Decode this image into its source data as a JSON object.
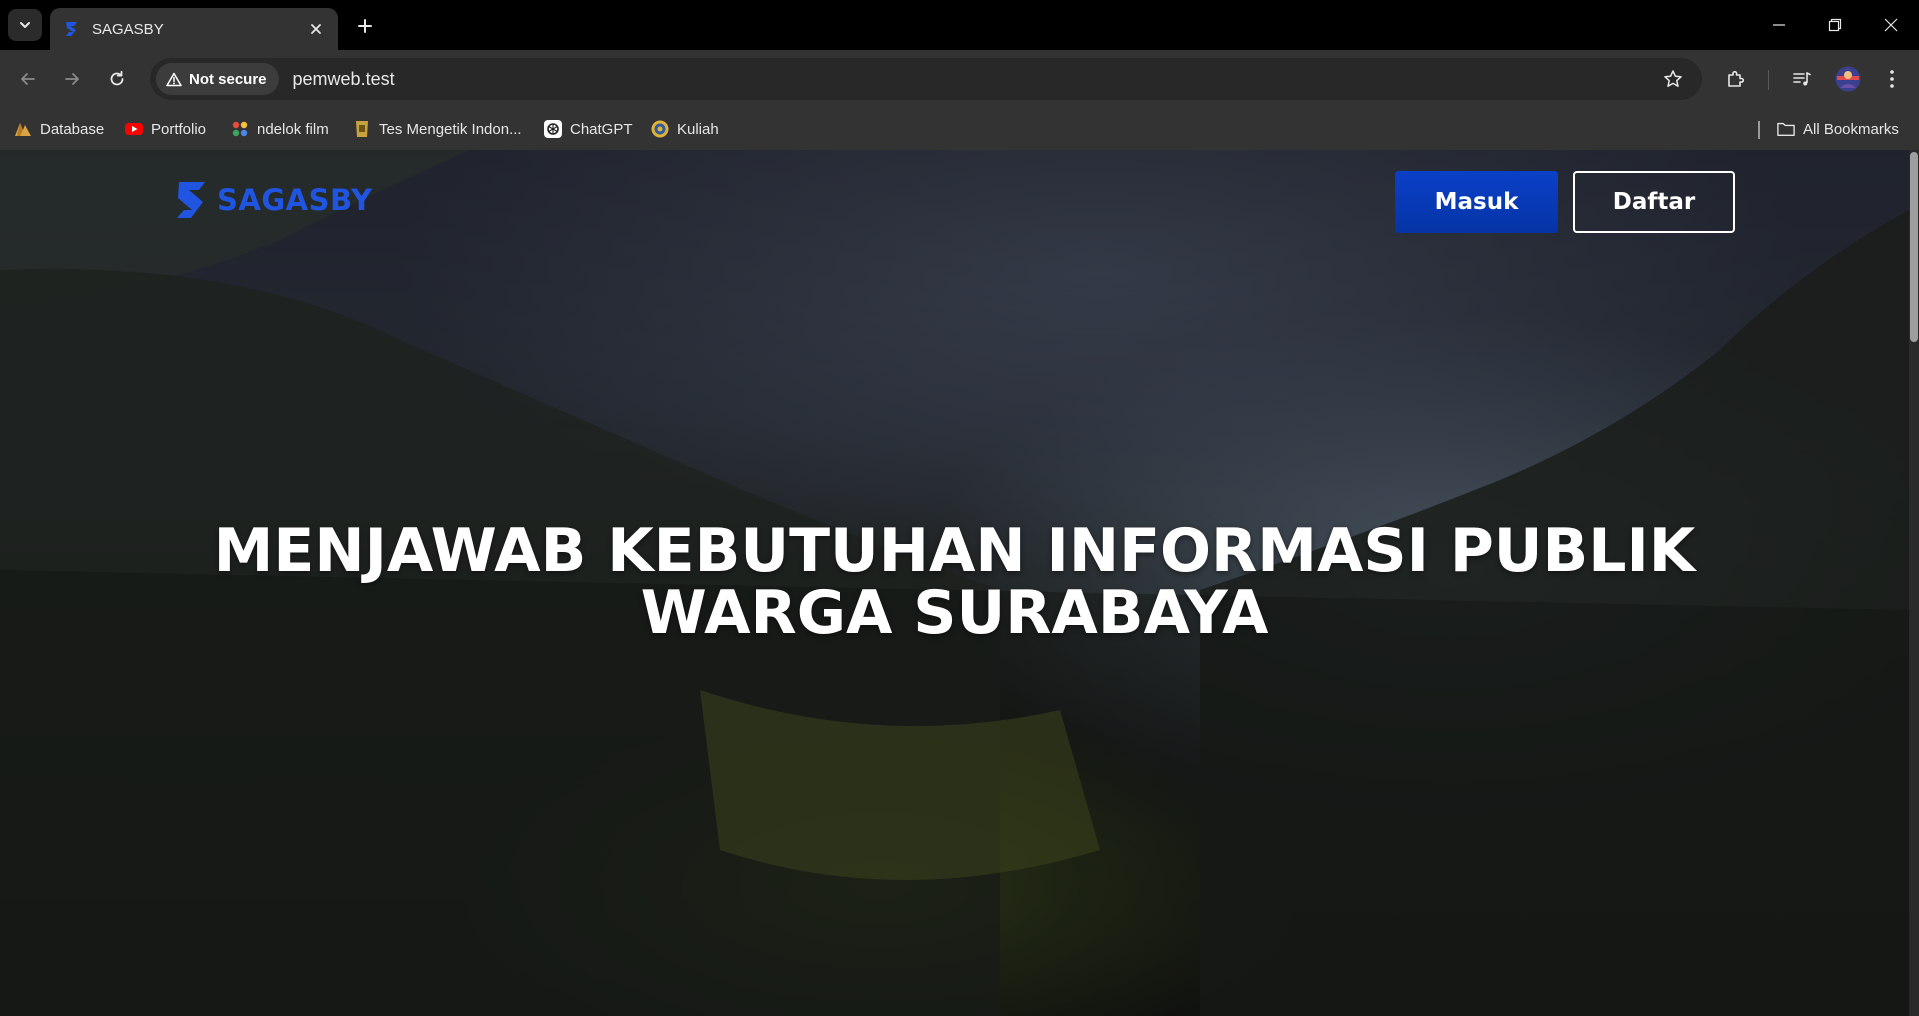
{
  "browser": {
    "tab": {
      "title": "SAGASBY"
    },
    "address": {
      "security_label": "Not secure",
      "url": "pemweb.test"
    },
    "bookmarks": [
      {
        "label": "Database",
        "icon": "database-icon"
      },
      {
        "label": "Portfolio",
        "icon": "youtube-icon"
      },
      {
        "label": "ndelok film",
        "icon": "film-icon"
      },
      {
        "label": "Tes Mengetik Indon...",
        "icon": "keyboard-site-icon"
      },
      {
        "label": "ChatGPT",
        "icon": "chatgpt-icon"
      },
      {
        "label": "Kuliah",
        "icon": "university-icon"
      }
    ],
    "all_bookmarks_label": "All Bookmarks"
  },
  "page": {
    "brand": {
      "name": "SAGASBY",
      "color": "#1f55e0"
    },
    "nav": {
      "login_label": "Masuk",
      "register_label": "Daftar",
      "login_color": "#0a40c8"
    },
    "hero": {
      "line1": "MENJAWAB KEBUTUHAN INFORMASI PUBLIK",
      "line2": "WARGA SURABAYA"
    },
    "background": "night village valley with terraced hills"
  }
}
